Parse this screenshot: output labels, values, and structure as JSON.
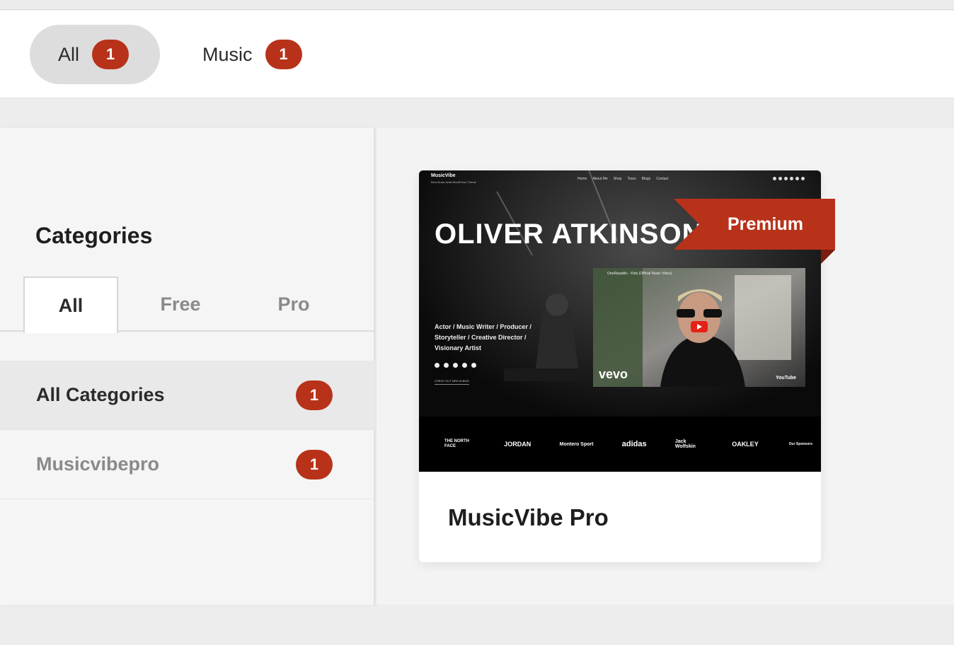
{
  "filter_bar": {
    "pills": [
      {
        "label": "All",
        "count": "1"
      },
      {
        "label": "Music",
        "count": "1"
      }
    ]
  },
  "sidebar": {
    "title": "Categories",
    "tabs": [
      "All",
      "Free",
      "Pro"
    ],
    "categories": [
      {
        "label": "All Categories",
        "count": "1"
      },
      {
        "label": "Musicvibepro",
        "count": "1"
      }
    ]
  },
  "card": {
    "title": "MusicVibe Pro",
    "badge": "Premium",
    "preview": {
      "site_name": "MusicVibe",
      "tagline": "Best Music Artist WordPress Theme",
      "nav": [
        "Home",
        "About Me",
        "Shop",
        "Tours",
        "Blogs",
        "Contact"
      ],
      "hero_title": "OLIVER ATKINSON",
      "hero_roles": [
        "Actor / Music Writer / Producer /",
        "Storyteller / Creative Director /",
        "Visionary Artist"
      ],
      "hero_cta": "CHECK OUT NEW ALBUM",
      "video_title": "OneRepublic - Kids (Official Music Video)",
      "video_watermark": "vevo",
      "video_platform": "YouTube",
      "sponsors": [
        "THE NORTH FACE",
        "JORDAN",
        "Montero Sport",
        "adidas",
        "Jack Wolfskin",
        "OAKLEY"
      ],
      "sponsors_label": "Our Sponsors"
    }
  },
  "colors": {
    "accent": "#b8321a",
    "badge_text": "#ffffff",
    "active_pill": "#dddddd"
  }
}
